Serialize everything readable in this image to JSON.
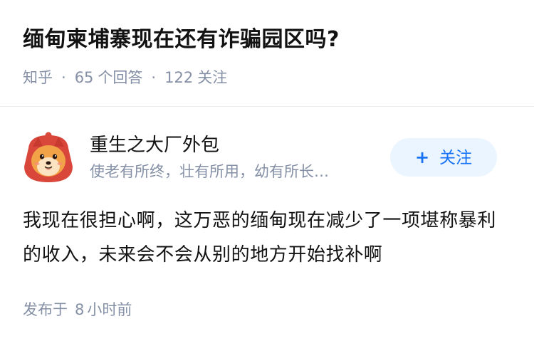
{
  "question": {
    "title": "缅甸柬埔寨现在还有诈骗园区吗?",
    "source": "知乎",
    "separator": "·",
    "answer_count": "65",
    "answer_label": "个回答",
    "follower_count": "122",
    "follower_label": "关注"
  },
  "answer": {
    "author": {
      "name": "重生之大厂外包",
      "bio": "使老有所终，壮有所用，幼有所长…",
      "avatar_icon": "cartoon-dog-avatar-icon"
    },
    "follow_button": {
      "icon": "+",
      "label": "关注"
    },
    "content": "我现在很担心啊，这万恶的缅甸现在减少了一项堪称暴利的收入，未来会不会从别的地方开始找补啊",
    "published_prefix": "发布于",
    "published_num": "8",
    "published_suffix": "小时前"
  },
  "colors": {
    "accent": "#1772f6",
    "follow_bg": "#ebf5ff",
    "meta": "#8590a6",
    "text": "#121212"
  }
}
